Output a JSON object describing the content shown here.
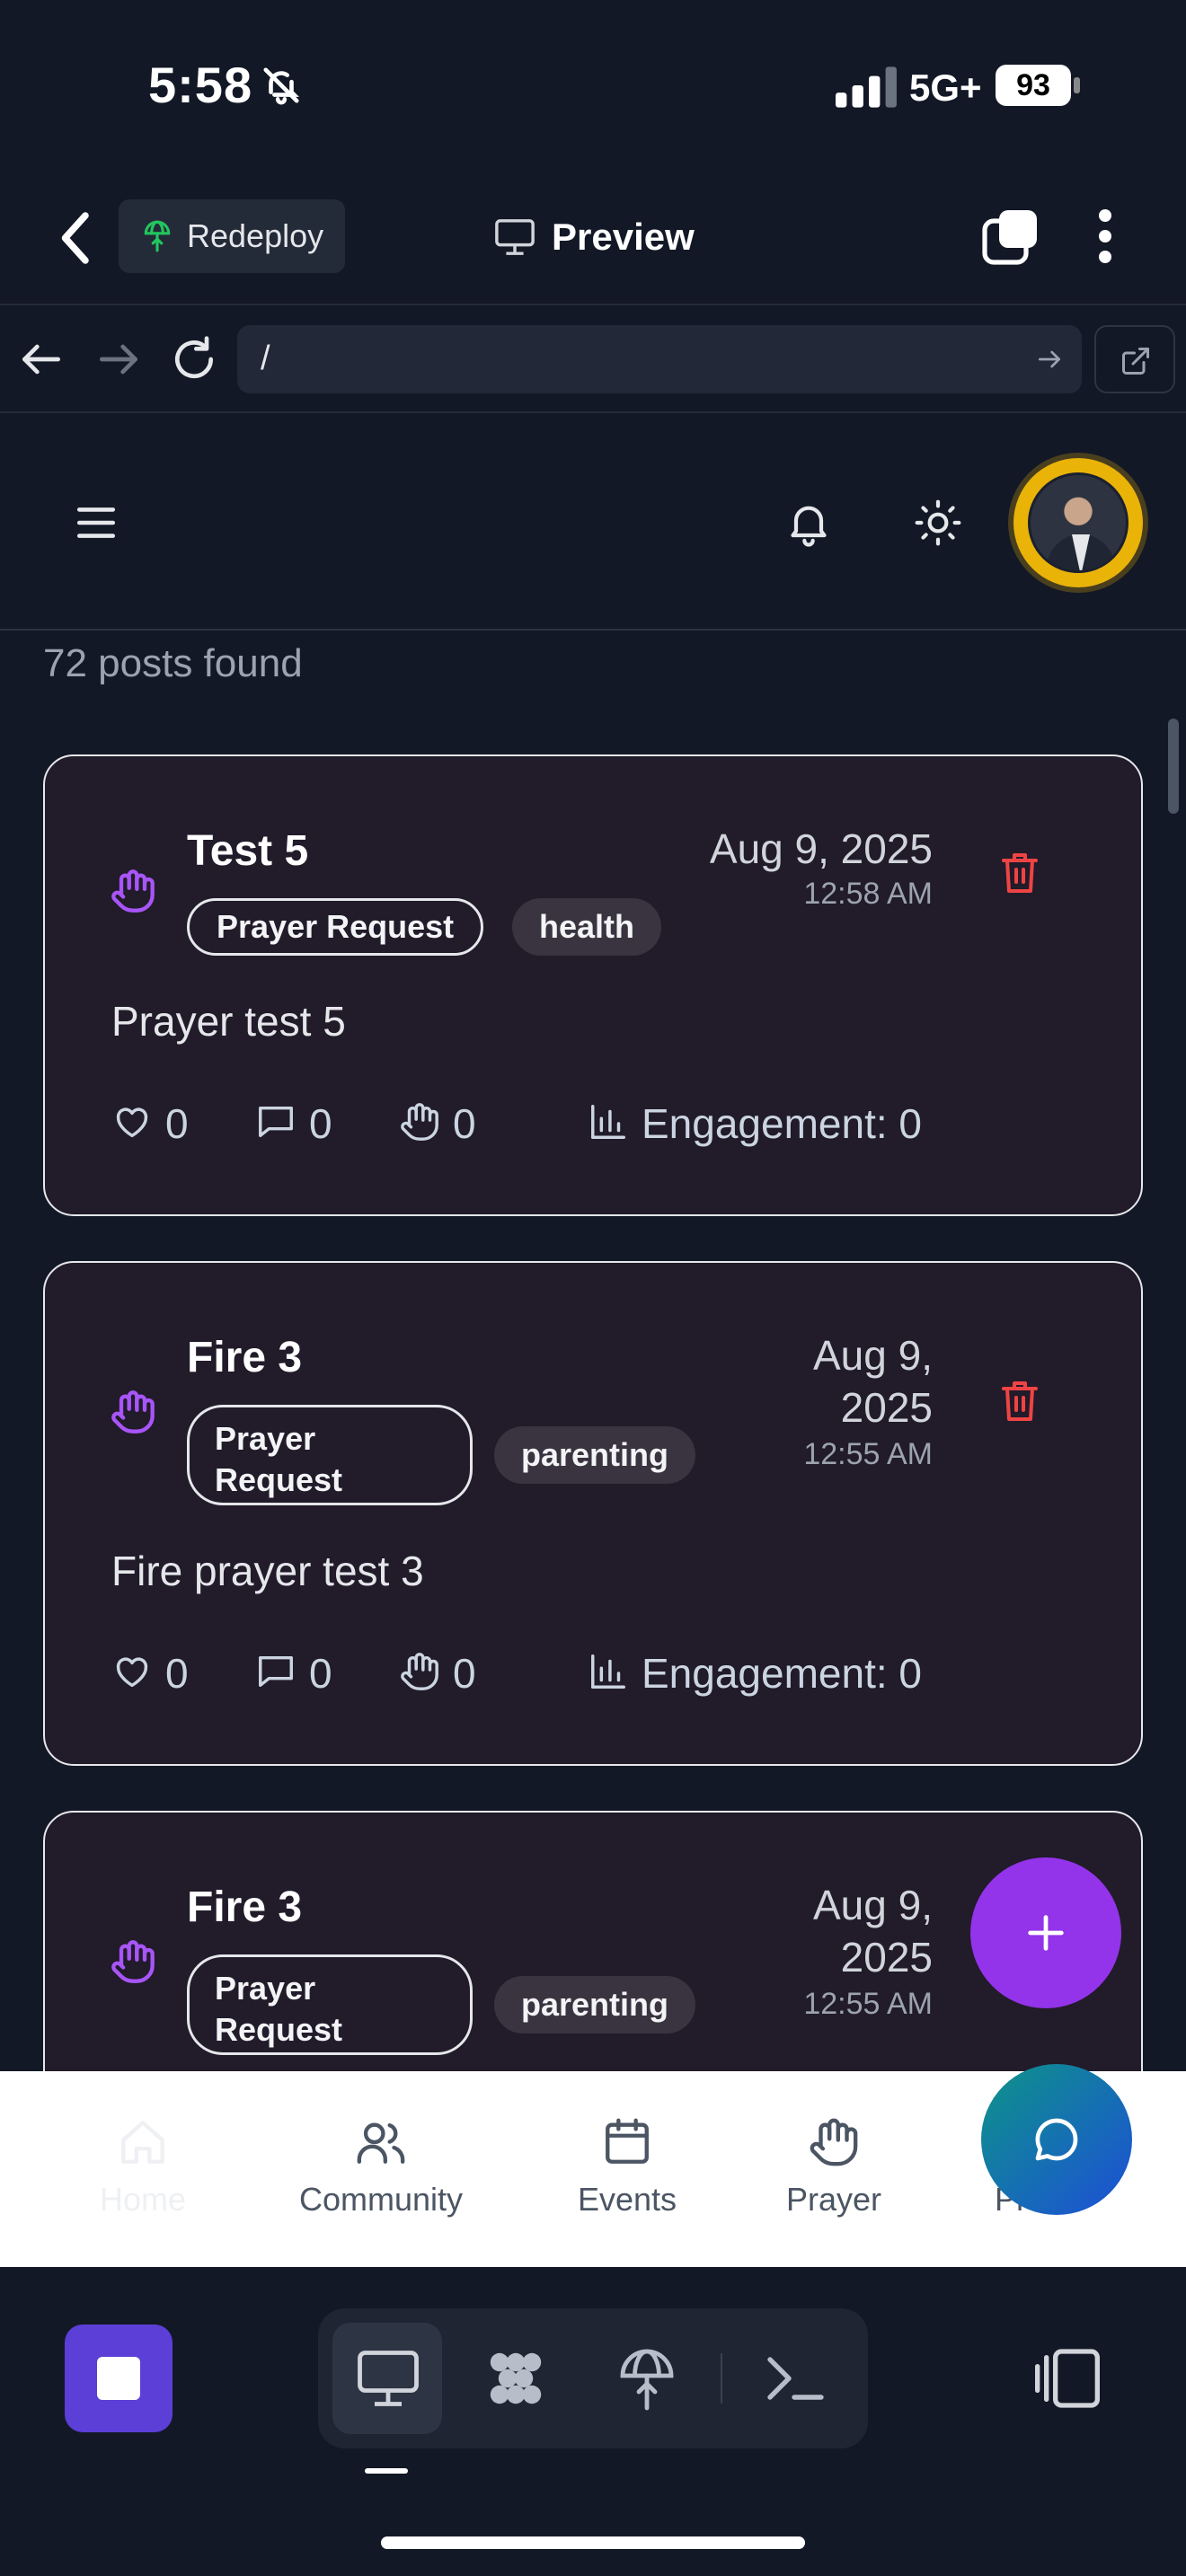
{
  "status": {
    "time": "5:58",
    "network": "5G+",
    "battery": "93"
  },
  "app_bar": {
    "redeploy": "Redeploy",
    "title": "Preview"
  },
  "browser": {
    "url": "/"
  },
  "feed": {
    "count_text": "72 posts found",
    "posts": [
      {
        "title": "Test 5",
        "category": "Prayer Request",
        "tag": "health",
        "date_line1": "Aug 9, 2025",
        "date_line2": "",
        "time": "12:58 AM",
        "body": "Prayer test 5",
        "likes": "0",
        "comments": "0",
        "prayers": "0",
        "engagement": "Engagement: 0"
      },
      {
        "title": "Fire 3",
        "category_line1": "Prayer",
        "category_line2": "Request",
        "tag": "parenting",
        "date_line1": "Aug 9,",
        "date_line2": "2025",
        "time": "12:55 AM",
        "body": "Fire prayer test 3",
        "likes": "0",
        "comments": "0",
        "prayers": "0",
        "engagement": "Engagement: 0"
      },
      {
        "title": "Fire 3",
        "category_line1": "Prayer",
        "category_line2": "Request",
        "tag": "parenting",
        "date_line1": "Aug 9,",
        "date_line2": "2025",
        "time": "12:55 AM"
      }
    ]
  },
  "bottom_nav": {
    "items": [
      {
        "label": "Home",
        "icon": "home-icon"
      },
      {
        "label": "Community",
        "icon": "users-icon"
      },
      {
        "label": "Events",
        "icon": "calendar-icon"
      },
      {
        "label": "Prayer",
        "icon": "hand-icon"
      },
      {
        "label": "Profile",
        "icon": "user-icon"
      }
    ]
  },
  "colors": {
    "background": "#131826",
    "card": "#211b2a",
    "accent_purple": "#9333ea",
    "danger": "#ef4444",
    "avatar_ring": "#eab308",
    "stop_button": "#5b3fd6"
  }
}
